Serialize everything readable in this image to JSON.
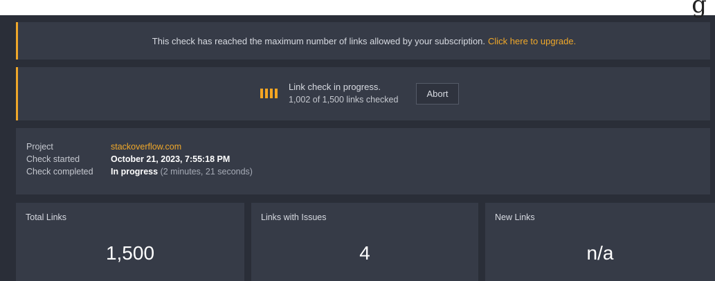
{
  "corner_glyph": "g",
  "banner": {
    "message": "This check has reached the maximum number of links allowed by your subscription.",
    "link_text": "Click here to upgrade."
  },
  "progress": {
    "title": "Link check in progress.",
    "detail": "1,002 of 1,500 links checked",
    "abort_label": "Abort",
    "checked": 1002,
    "total": 1500
  },
  "info": {
    "project_label": "Project",
    "project_value": "stackoverflow.com",
    "started_label": "Check started",
    "started_value": "October 21, 2023, 7:55:18 PM",
    "completed_label": "Check completed",
    "completed_value": "In progress",
    "completed_duration": "(2 minutes, 21 seconds)"
  },
  "stats": {
    "total": {
      "label": "Total Links",
      "value": "1,500"
    },
    "issues": {
      "label": "Links with Issues",
      "value": "4"
    },
    "new": {
      "label": "New Links",
      "value": "n/a"
    }
  },
  "colors": {
    "accent": "#f0a82a",
    "panel": "#363b47",
    "background": "#2a2e38"
  }
}
